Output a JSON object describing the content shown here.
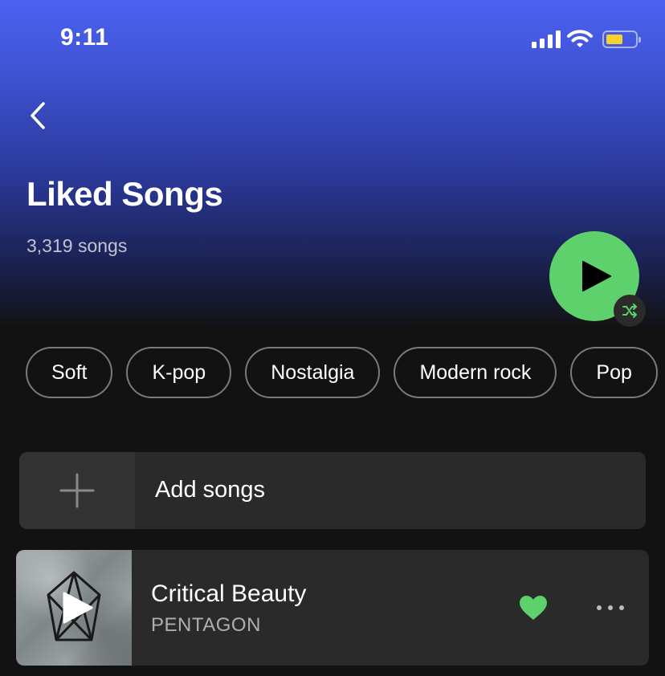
{
  "status_bar": {
    "time": "9:11",
    "battery_level": 0.6,
    "battery_color": "#f7d22d"
  },
  "header": {
    "title": "Liked Songs",
    "song_count": "3,319 songs"
  },
  "icons": {
    "back": "chevron-left-icon",
    "play": "play-icon",
    "shuffle": "shuffle-icon",
    "add": "plus-icon",
    "liked": "heart-icon",
    "more": "more-horizontal-icon"
  },
  "filters": [
    "Soft",
    "K-pop",
    "Nostalgia",
    "Modern rock",
    "Pop"
  ],
  "add_songs": {
    "label": "Add songs"
  },
  "tracks": [
    {
      "title": "Critical Beauty",
      "artist": "PENTAGON",
      "liked": true
    }
  ],
  "colors": {
    "accent_green": "#5ed06c",
    "header_gradient_top": "#4a62f0",
    "background": "#121212",
    "row_background": "#2a2a2a"
  }
}
